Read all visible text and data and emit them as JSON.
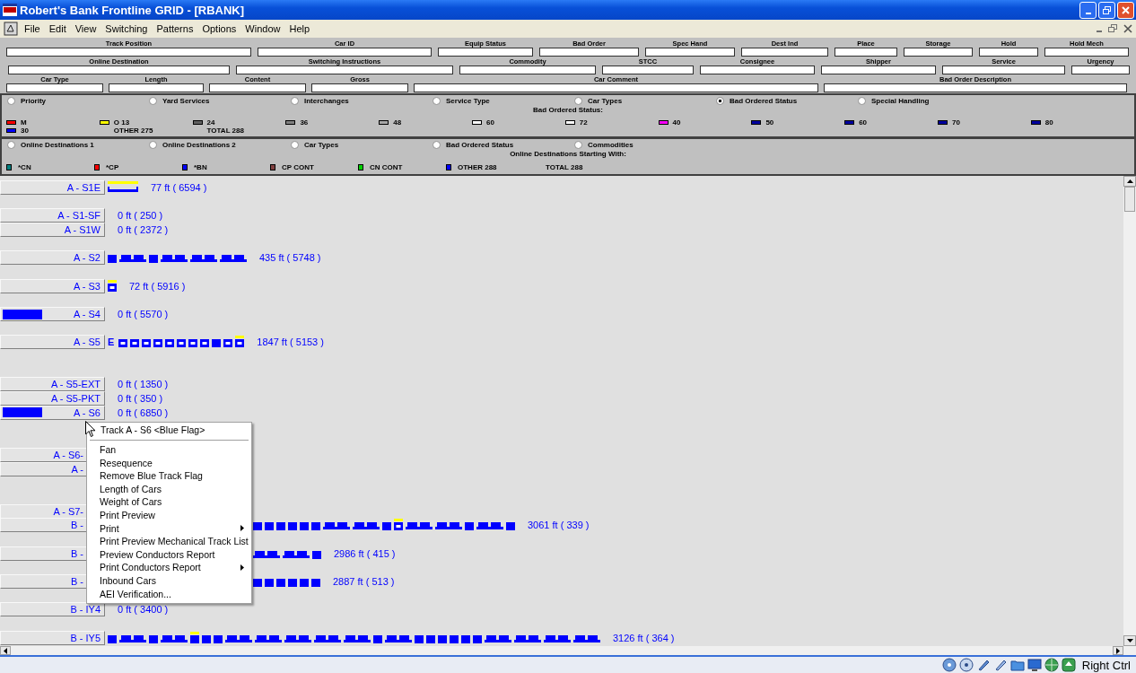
{
  "window": {
    "title": "Robert's Bank Frontline GRID - [RBANK]"
  },
  "menu": [
    "File",
    "Edit",
    "View",
    "Switching",
    "Patterns",
    "Options",
    "Window",
    "Help"
  ],
  "field_rows": [
    {
      "fields": [
        {
          "label": "Track Position"
        },
        {
          "label": "Car ID"
        },
        {
          "label": "Equip Status"
        },
        {
          "label": "Bad Order"
        },
        {
          "label": "Spec Hand"
        },
        {
          "label": "Dest Ind"
        },
        {
          "label": "Place"
        },
        {
          "label": "Storage"
        },
        {
          "label": "Hold"
        },
        {
          "label": "Hold Mech"
        }
      ]
    },
    {
      "fields": [
        {
          "label": "Online Destination"
        },
        {
          "label": "Switching Instructions"
        },
        {
          "label": "Commodity"
        },
        {
          "label": "STCC"
        },
        {
          "label": "Consignee"
        },
        {
          "label": "Shipper"
        },
        {
          "label": "Service"
        },
        {
          "label": "Urgency"
        }
      ]
    },
    {
      "fields": [
        {
          "label": "Car Type"
        },
        {
          "label": "Length"
        },
        {
          "label": "Content"
        },
        {
          "label": "Gross"
        },
        {
          "label": "Car Comment"
        },
        {
          "label": "Bad Order Description"
        }
      ]
    }
  ],
  "panels": [
    {
      "options": [
        {
          "label": "Priority",
          "selected": false
        },
        {
          "label": "Yard Services",
          "selected": false
        },
        {
          "label": "Interchanges",
          "selected": false
        },
        {
          "label": "Service Type",
          "selected": false
        },
        {
          "label": "Car Types",
          "selected": false
        },
        {
          "label": "Bad Ordered Status",
          "selected": true
        },
        {
          "label": "Special Handling",
          "selected": false
        }
      ],
      "caption": "Bad Ordered Status:",
      "legend": [
        {
          "entries": [
            {
              "label": "M",
              "color": "#ff0000"
            },
            {
              "label": "30",
              "color": "#0000ff"
            }
          ]
        },
        {
          "entries": [
            {
              "label": "O 13",
              "color": "#ffff00"
            },
            {
              "label": "OTHER  275"
            }
          ]
        },
        {
          "entries": [
            {
              "label": "24",
              "color": "#606060"
            },
            {
              "label": "TOTAL 288"
            }
          ]
        },
        {
          "entries": [
            {
              "label": "36",
              "color": "#808080"
            }
          ]
        },
        {
          "entries": [
            {
              "label": "48",
              "color": "#a8a8a8"
            }
          ]
        },
        {
          "entries": [
            {
              "label": "60",
              "color": "#ffffff"
            }
          ]
        },
        {
          "entries": [
            {
              "label": "72",
              "color": "#ffffff"
            }
          ]
        },
        {
          "entries": [
            {
              "label": "40",
              "color": "#ff00ff"
            }
          ]
        },
        {
          "entries": [
            {
              "label": "50",
              "color": "#0000a0"
            }
          ]
        },
        {
          "entries": [
            {
              "label": "60",
              "color": "#0000a0"
            }
          ]
        },
        {
          "entries": [
            {
              "label": "70",
              "color": "#0000a0"
            }
          ]
        },
        {
          "entries": [
            {
              "label": "80",
              "color": "#0000a0"
            }
          ]
        }
      ]
    },
    {
      "options": [
        {
          "label": "Online Destinations 1",
          "selected": false
        },
        {
          "label": "Online Destinations 2",
          "selected": false
        },
        {
          "label": "Car Types",
          "selected": false
        },
        {
          "label": "Bad Ordered Status",
          "selected": false
        },
        {
          "label": "Commodities",
          "selected": false
        }
      ],
      "caption": "Online Destinations Starting With:",
      "legend": [
        {
          "entries": [
            {
              "label": "*CN",
              "color": "#008080"
            }
          ]
        },
        {
          "entries": [
            {
              "label": "*CP",
              "color": "#ff0000"
            }
          ]
        },
        {
          "entries": [
            {
              "label": "*BN",
              "color": "#0000ff"
            }
          ]
        },
        {
          "entries": [
            {
              "label": "CP CONT",
              "color": "#804040"
            }
          ]
        },
        {
          "entries": [
            {
              "label": "CN CONT",
              "color": "#00d000"
            }
          ]
        },
        {
          "entries": [
            {
              "label": "OTHER  288",
              "color": "#0000ff"
            }
          ]
        },
        {
          "entries": [
            {
              "label": "TOTAL 288"
            }
          ]
        }
      ]
    }
  ],
  "tracks": [
    {
      "kind": "track",
      "label": "A - S1E",
      "blue_flag": false,
      "covered": false,
      "reading": "77 ft ( 6594 )",
      "cars": [
        {
          "kind": "flat",
          "flagged": true
        }
      ]
    },
    {
      "kind": "gap"
    },
    {
      "kind": "track",
      "label": "A - S1-SF",
      "blue_flag": false,
      "covered": false,
      "reading": "0 ft ( 250 )"
    },
    {
      "kind": "track",
      "label": "A - S1W",
      "blue_flag": false,
      "covered": false,
      "reading": "0 ft ( 2372 )"
    },
    {
      "kind": "gap"
    },
    {
      "kind": "track",
      "label": "A - S2",
      "blue_flag": false,
      "covered": false,
      "reading": "435 ft ( 5748 )",
      "cars": [
        {
          "kind": "box",
          "flagged": false
        },
        {
          "kind": "double",
          "flagged": false
        },
        {
          "kind": "box",
          "flagged": false
        },
        {
          "kind": "double",
          "flagged": false
        },
        {
          "kind": "double",
          "flagged": false
        },
        {
          "kind": "double",
          "flagged": false
        }
      ]
    },
    {
      "kind": "gap"
    },
    {
      "kind": "track",
      "label": "A - S3",
      "blue_flag": false,
      "covered": false,
      "reading": "72 ft ( 5916 )",
      "cars": [
        {
          "kind": "empty",
          "flagged": true
        }
      ]
    },
    {
      "kind": "gap"
    },
    {
      "kind": "track",
      "label": "A - S4",
      "blue_flag": true,
      "covered": false,
      "reading": "0 ft ( 5570 )"
    },
    {
      "kind": "gap"
    },
    {
      "kind": "track",
      "label": "A - S5",
      "blue_flag": false,
      "covered": false,
      "reading": "1847 ft ( 5153 )",
      "cars": [
        {
          "kind": "mark",
          "text": "E",
          "flagged": false
        },
        {
          "kind": "empty",
          "flagged": false
        },
        {
          "kind": "empty",
          "flagged": false
        },
        {
          "kind": "empty",
          "flagged": false
        },
        {
          "kind": "empty",
          "flagged": false
        },
        {
          "kind": "empty",
          "flagged": false
        },
        {
          "kind": "empty",
          "flagged": false
        },
        {
          "kind": "empty",
          "flagged": false
        },
        {
          "kind": "empty",
          "flagged": false
        },
        {
          "kind": "box",
          "flagged": false
        },
        {
          "kind": "empty",
          "flagged": false
        },
        {
          "kind": "empty",
          "flagged": true
        }
      ]
    },
    {
      "kind": "gap"
    },
    {
      "kind": "gap"
    },
    {
      "kind": "track",
      "label": "A - S5-EXT",
      "blue_flag": false,
      "covered": false,
      "reading": "0 ft ( 1350 )"
    },
    {
      "kind": "track",
      "label": "A - S5-PKT",
      "blue_flag": false,
      "covered": false,
      "reading": "0 ft ( 350 )"
    },
    {
      "kind": "track",
      "label": "A - S6",
      "blue_flag": true,
      "covered": false,
      "reading": "0 ft ( 6850 )"
    },
    {
      "kind": "gap"
    },
    {
      "kind": "gap"
    },
    {
      "kind": "track",
      "label": "A - S6-",
      "blue_flag": false,
      "covered": true
    },
    {
      "kind": "track",
      "label": "A -",
      "blue_flag": false,
      "covered": true
    },
    {
      "kind": "gap"
    },
    {
      "kind": "gap"
    },
    {
      "kind": "track",
      "label": "A - S7-",
      "blue_flag": false,
      "covered": true
    },
    {
      "kind": "track",
      "label": "B -",
      "blue_flag": false,
      "covered": true,
      "reading": "3061 ft ( 339 )",
      "cars": [
        {
          "kind": "box",
          "flagged": false
        },
        {
          "kind": "box",
          "flagged": false
        },
        {
          "kind": "box",
          "flagged": false
        },
        {
          "kind": "box",
          "flagged": false
        },
        {
          "kind": "box",
          "flagged": false
        },
        {
          "kind": "box",
          "flagged": false
        },
        {
          "kind": "double",
          "flagged": false
        },
        {
          "kind": "double",
          "flagged": false
        },
        {
          "kind": "box",
          "flagged": false
        },
        {
          "kind": "empty",
          "flagged": true
        },
        {
          "kind": "double",
          "flagged": false
        },
        {
          "kind": "double",
          "flagged": false
        },
        {
          "kind": "box",
          "flagged": false
        },
        {
          "kind": "double",
          "flagged": false
        },
        {
          "kind": "box",
          "flagged": false
        }
      ]
    },
    {
      "kind": "gap"
    },
    {
      "kind": "track",
      "label": "B -",
      "blue_flag": false,
      "covered": true,
      "reading": "2986 ft ( 415 )",
      "cars": [
        {
          "kind": "double",
          "flagged": false
        },
        {
          "kind": "double",
          "flagged": false
        },
        {
          "kind": "box",
          "flagged": false
        }
      ]
    },
    {
      "kind": "gap"
    },
    {
      "kind": "track",
      "label": "B -",
      "blue_flag": false,
      "covered": true,
      "reading": "2887 ft ( 513 )",
      "cars": [
        {
          "kind": "box",
          "flagged": false
        },
        {
          "kind": "box",
          "flagged": false
        },
        {
          "kind": "box",
          "flagged": false
        },
        {
          "kind": "box",
          "flagged": false
        },
        {
          "kind": "box",
          "flagged": false
        },
        {
          "kind": "box",
          "flagged": false
        }
      ]
    },
    {
      "kind": "gap"
    },
    {
      "kind": "track",
      "label": "B - IY4",
      "blue_flag": false,
      "covered": false,
      "reading": "0 ft ( 3400 )"
    },
    {
      "kind": "gap"
    },
    {
      "kind": "track",
      "label": "B - IY5",
      "blue_flag": false,
      "covered": false,
      "reading": "3126 ft ( 364 )",
      "cars": [
        {
          "kind": "box",
          "flagged": false
        },
        {
          "kind": "double",
          "flagged": false
        },
        {
          "kind": "box",
          "flagged": false
        },
        {
          "kind": "double",
          "flagged": false
        },
        {
          "kind": "box",
          "flagged": true
        },
        {
          "kind": "box",
          "flagged": false
        },
        {
          "kind": "box",
          "flagged": false
        },
        {
          "kind": "double",
          "flagged": false
        },
        {
          "kind": "double",
          "flagged": false
        },
        {
          "kind": "double",
          "flagged": false
        },
        {
          "kind": "double",
          "flagged": false
        },
        {
          "kind": "double",
          "flagged": false
        },
        {
          "kind": "box",
          "flagged": false
        },
        {
          "kind": "double",
          "flagged": false
        },
        {
          "kind": "box",
          "flagged": false
        },
        {
          "kind": "box",
          "flagged": false
        },
        {
          "kind": "box",
          "flagged": false
        },
        {
          "kind": "box",
          "flagged": false
        },
        {
          "kind": "box",
          "flagged": false
        },
        {
          "kind": "box",
          "flagged": false
        },
        {
          "kind": "double",
          "flagged": false
        },
        {
          "kind": "double",
          "flagged": false
        },
        {
          "kind": "double",
          "flagged": false
        },
        {
          "kind": "double",
          "flagged": false
        }
      ]
    }
  ],
  "context_menu": {
    "title": "Track A - S6  <Blue Flag>",
    "items": [
      {
        "label": "Fan",
        "submenu": false
      },
      {
        "label": "Resequence",
        "submenu": false
      },
      {
        "label": "Remove Blue Track Flag",
        "submenu": false
      },
      {
        "label": "Length of Cars",
        "submenu": false
      },
      {
        "label": "Weight of Cars",
        "submenu": false
      },
      {
        "label": "Print Preview",
        "submenu": false
      },
      {
        "label": "Print",
        "submenu": true
      },
      {
        "label": "Print Preview Mechanical Track List",
        "submenu": false
      },
      {
        "label": "Preview Conductors Report",
        "submenu": false
      },
      {
        "label": "Print Conductors Report",
        "submenu": true
      },
      {
        "label": "Inbound Cars",
        "submenu": false
      },
      {
        "label": "AEI Verification...",
        "submenu": false
      }
    ]
  },
  "status_bar": {
    "host_key": "Right Ctrl"
  }
}
